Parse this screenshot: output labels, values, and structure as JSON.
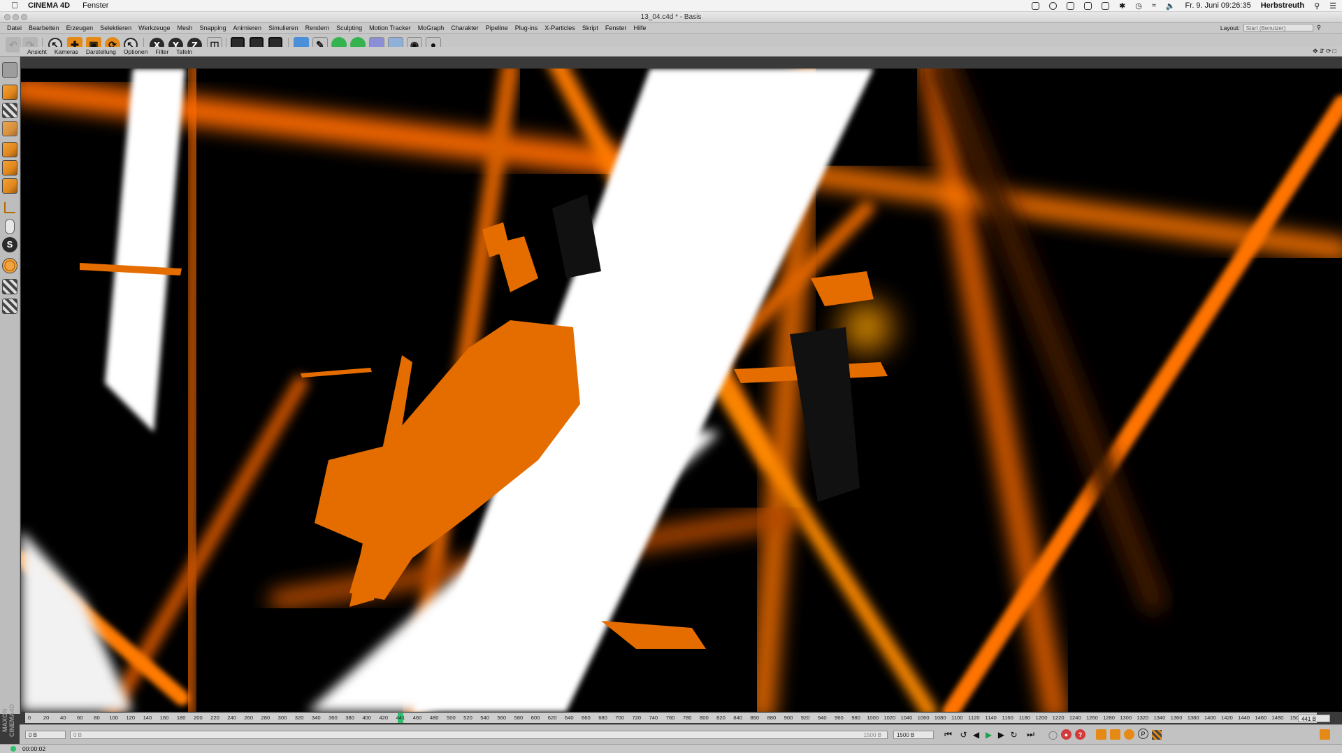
{
  "macos": {
    "app_name": "CINEMA 4D",
    "menu": [
      "Fenster"
    ],
    "datetime": "Fr. 9. Juni  09:26:35",
    "user": "Herbstreuth"
  },
  "window": {
    "title": "13_04.c4d * - Basis"
  },
  "menubar": {
    "items": [
      "Datei",
      "Bearbeiten",
      "Erzeugen",
      "Selektieren",
      "Werkzeuge",
      "Mesh",
      "Snapping",
      "Animieren",
      "Simulieren",
      "Rendern",
      "Sculpting",
      "Motion Tracker",
      "MoGraph",
      "Charakter",
      "Pipeline",
      "Plug-ins",
      "X-Particles",
      "Skript",
      "Fenster",
      "Hilfe"
    ],
    "layout_label": "Layout:",
    "layout_value": "Start (Benutzer)"
  },
  "toolbar": {
    "axis_x": "X",
    "axis_y": "Y",
    "axis_z": "Z"
  },
  "viewport_menu": {
    "items": [
      "Ansicht",
      "Kameras",
      "Darstellung",
      "Optionen",
      "Filter",
      "Tafeln"
    ]
  },
  "timeline": {
    "ticks": [
      "0",
      "20",
      "40",
      "60",
      "80",
      "100",
      "120",
      "140",
      "160",
      "180",
      "200",
      "220",
      "240",
      "260",
      "280",
      "300",
      "320",
      "340",
      "360",
      "380",
      "400",
      "420",
      "441",
      "460",
      "480",
      "500",
      "520",
      "540",
      "560",
      "580",
      "600",
      "620",
      "640",
      "660",
      "680",
      "700",
      "720",
      "740",
      "760",
      "780",
      "800",
      "820",
      "840",
      "860",
      "880",
      "900",
      "920",
      "940",
      "960",
      "980",
      "1000",
      "1020",
      "1040",
      "1060",
      "1080",
      "1100",
      "1120",
      "1140",
      "1160",
      "1180",
      "1200",
      "1220",
      "1240",
      "1260",
      "1280",
      "1300",
      "1320",
      "1340",
      "1360",
      "1380",
      "1400",
      "1420",
      "1440",
      "1460",
      "1480",
      "150"
    ],
    "current_frame": 441,
    "current_frame_field": "441 B",
    "start_field": "0 B",
    "range_start_field": "0 B",
    "range_end_field": "1500 B",
    "end_field": "1500 B"
  },
  "logo": "MAXON CINEMA 4D",
  "status": {
    "time": "00:00:02"
  },
  "colors": {
    "accent_orange": "#e58a16",
    "playhead_green": "#2ebf6f",
    "viewport_bg": "#000000"
  }
}
